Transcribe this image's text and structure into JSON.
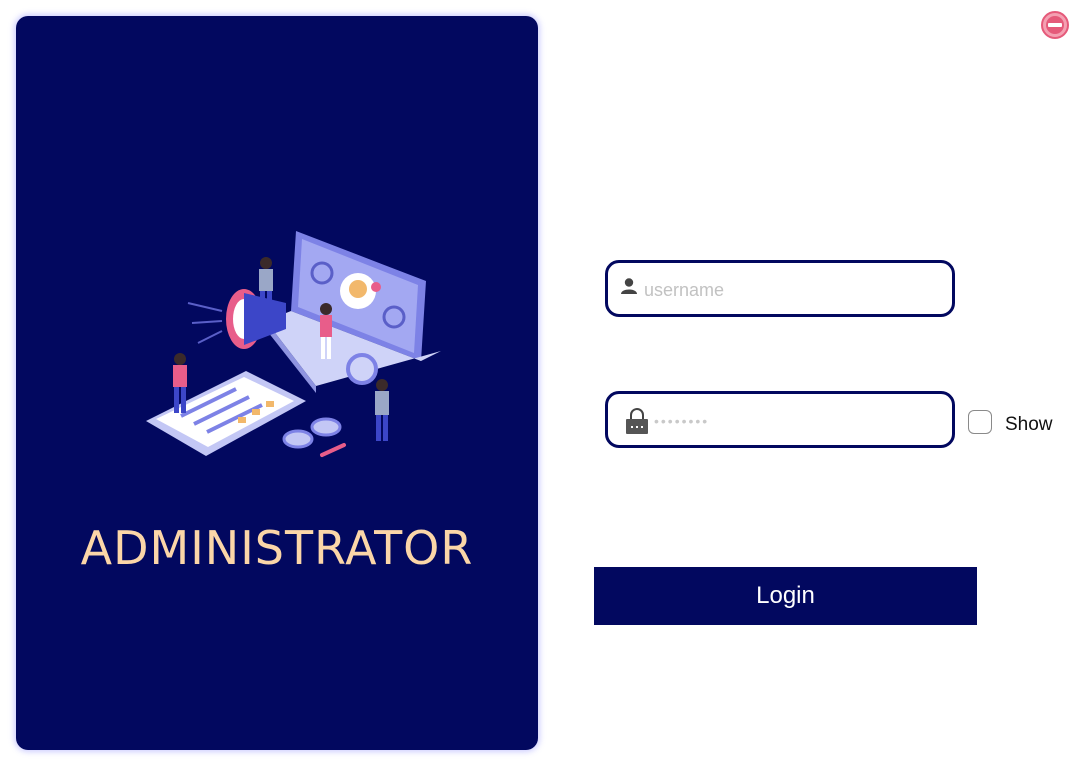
{
  "left_panel": {
    "title": "ADMINISTRATOR",
    "illustration": "admin-team-laptop-megaphone-illustration"
  },
  "exit_button": {
    "icon": "exit-icon"
  },
  "login_form": {
    "username": {
      "placeholder": "username",
      "value": "",
      "icon": "user-icon"
    },
    "password": {
      "masked_value": "••••••••",
      "icon": "lock-icon"
    },
    "show_toggle": {
      "label": "Show",
      "checked": false
    },
    "submit_label": "Login"
  },
  "colors": {
    "panel_background": "#02085f",
    "title_color": "#fbd6a8",
    "field_border": "#02085f",
    "button_background": "#02085f",
    "exit_icon": "#e55a7a"
  }
}
